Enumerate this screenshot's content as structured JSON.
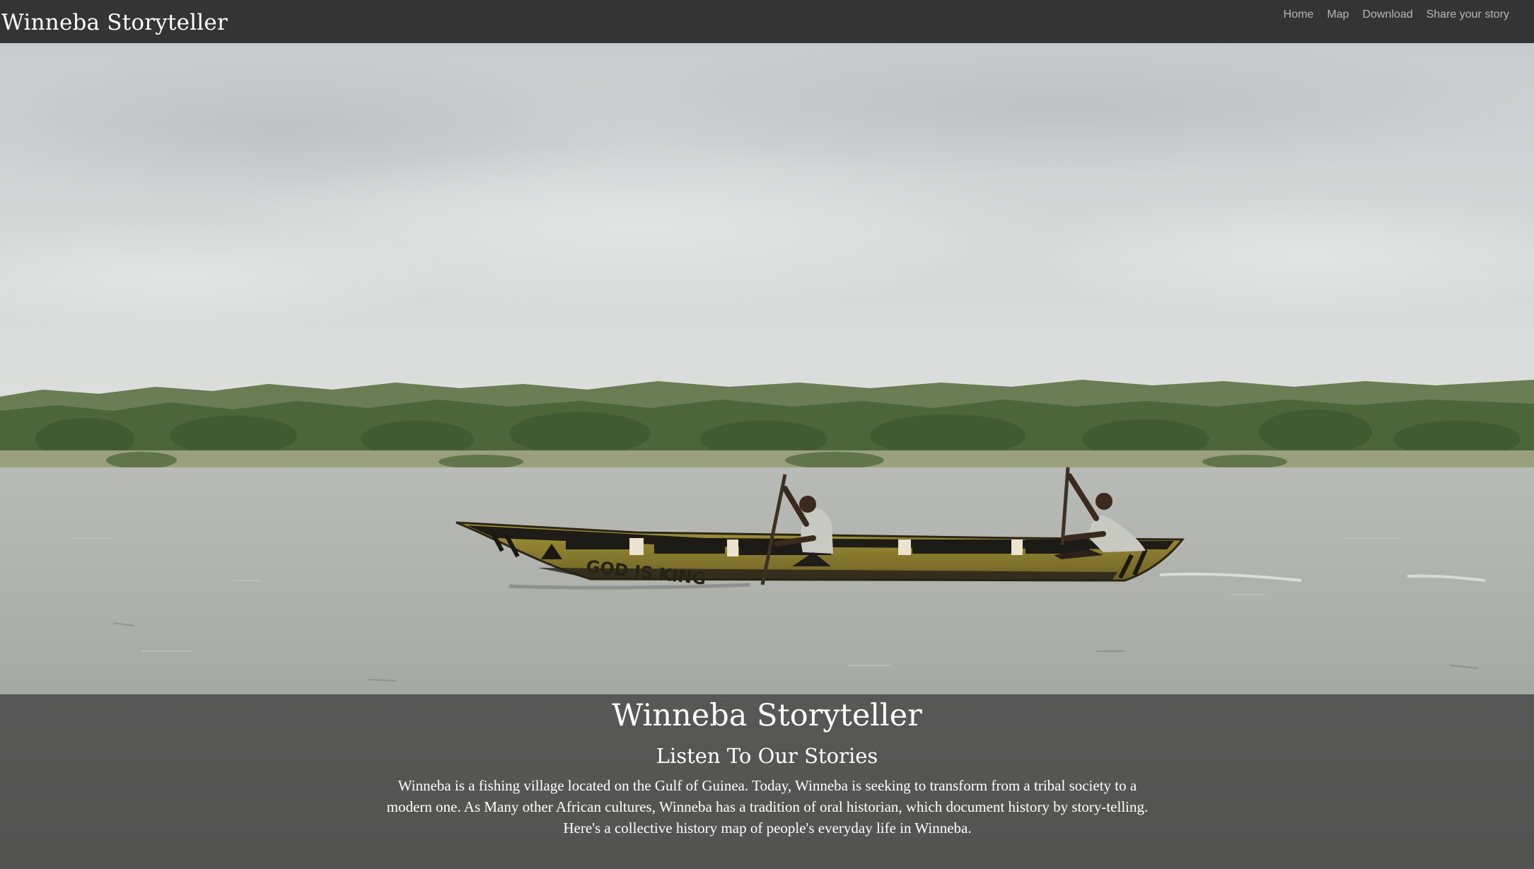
{
  "navbar": {
    "brand": "Winneba Storyteller",
    "links": [
      {
        "label": "Home"
      },
      {
        "label": "Map"
      },
      {
        "label": "Download"
      },
      {
        "label": "Share your story"
      }
    ]
  },
  "hero": {
    "sky_color": "#cfd1d2",
    "water_color": "#9b9d98",
    "treeline_color": "#4f6a3c",
    "canoe_color": "#8f7f2e",
    "canoe_text": "GOD IS KING"
  },
  "caption": {
    "title": "Winneba Storyteller",
    "subtitle": "Listen To Our Stories",
    "paragraph": "Winneba is a fishing village located on the Gulf of Guinea. Today, Winneba is seeking to transform from a tribal society to a modern one. As Many other African cultures, Winneba has a tradition of oral historian, which document history by story-telling.",
    "closing": "Here's a collective history map of people's everyday life in Winneba."
  }
}
